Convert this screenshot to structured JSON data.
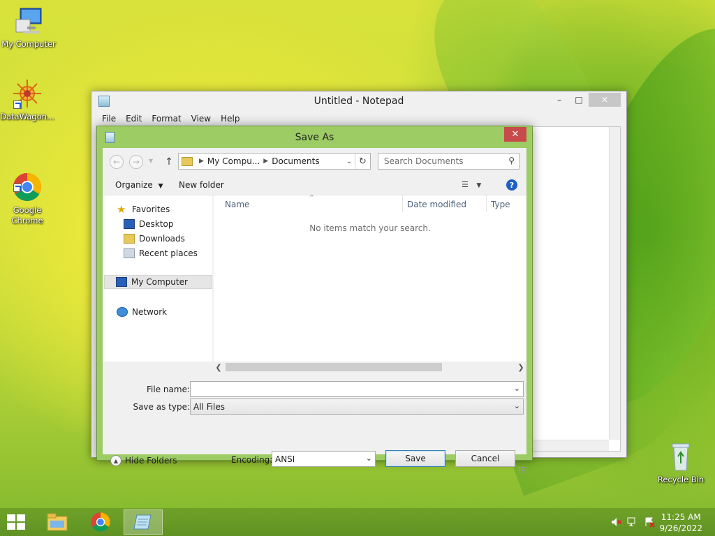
{
  "desktop": {
    "icons": [
      {
        "label": "My Computer"
      },
      {
        "label": "DataWagon..."
      },
      {
        "label": "Google\nChrome"
      },
      {
        "label": "Recycle Bin"
      }
    ]
  },
  "notepad": {
    "title": "Untitled - Notepad",
    "menu": [
      "File",
      "Edit",
      "Format",
      "View",
      "Help"
    ]
  },
  "dialog": {
    "title": "Save As",
    "close_label": "✕",
    "address": {
      "segments": [
        "My Compu...",
        "Documents"
      ]
    },
    "search_placeholder": "Search Documents",
    "toolbar": {
      "organize": "Organize",
      "new_folder": "New folder"
    },
    "nav": {
      "favorites": "Favorites",
      "desktop": "Desktop",
      "downloads": "Downloads",
      "recent": "Recent places",
      "computer": "My Computer",
      "network": "Network"
    },
    "columns": [
      "Name",
      "Date modified",
      "Type"
    ],
    "empty_message": "No items match your search.",
    "file_name_label": "File name:",
    "file_name_value": "",
    "save_type_label": "Save as type:",
    "save_type_value": "All Files",
    "hide_folders": "Hide Folders",
    "encoding_label": "Encoding:",
    "encoding_value": "ANSI",
    "save_button": "Save",
    "cancel_button": "Cancel"
  },
  "taskbar": {
    "time": "11:25 AM",
    "date": "9/26/2022"
  },
  "colors": {
    "dialog_frame": "#9ccc63",
    "close_red": "#c74b4b",
    "taskbar": "#6a9e2a"
  }
}
